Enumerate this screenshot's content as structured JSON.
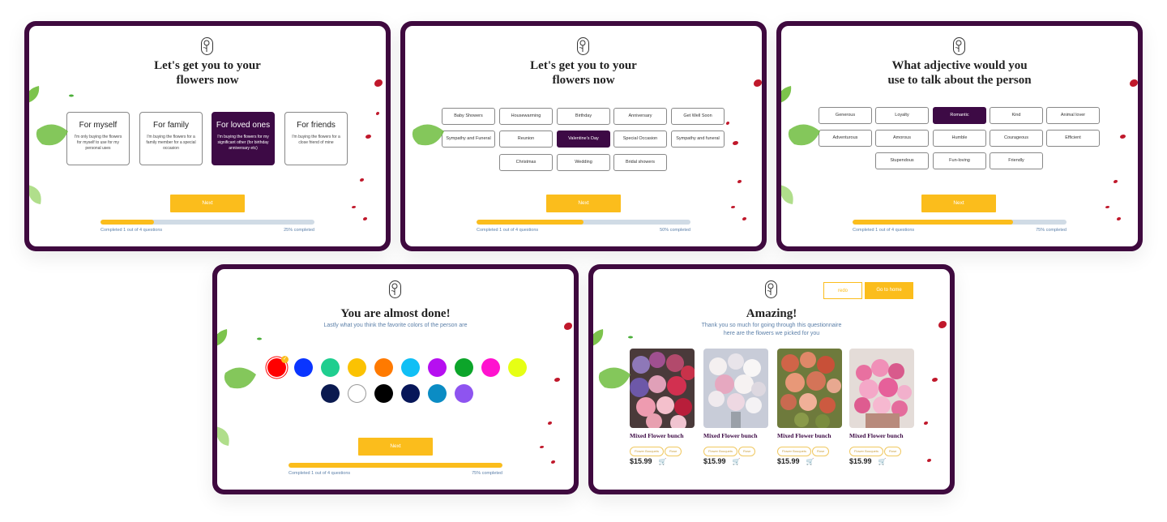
{
  "screens": {
    "s1": {
      "title_line1": "Let's get you to your",
      "title_line2": "flowers now",
      "cards": [
        {
          "title": "For myself",
          "desc": "I'm only buying the flowers for myself to use for my personal uses",
          "selected": false
        },
        {
          "title": "For family",
          "desc": "I'm buying the flowers for a family member for a special occasion",
          "selected": false
        },
        {
          "title": "For loved ones",
          "desc": "I'm buying the flowers for my significant other (for birthday anniversary etc)",
          "selected": true
        },
        {
          "title": "For friends",
          "desc": "I'm buying the flowers for a close friend of mine",
          "selected": false
        }
      ],
      "next_label": "Next",
      "progress_left": "Completed 1 out of 4 questions",
      "progress_right": "25% completed",
      "progress_value": 0.25
    },
    "s2": {
      "title_line1": "Let's get you to your",
      "title_line2": "flowers now",
      "chips": [
        {
          "label": "Baby Showers",
          "selected": false
        },
        {
          "label": "Housewarming",
          "selected": false
        },
        {
          "label": "Birthday",
          "selected": false
        },
        {
          "label": "Anniversary",
          "selected": false
        },
        {
          "label": "Get Well Soon",
          "selected": false
        },
        {
          "label": "Sympathy and Funeral",
          "selected": false
        },
        {
          "label": "Reunion",
          "selected": false
        },
        {
          "label": "Valentine's Day",
          "selected": true
        },
        {
          "label": "Special Occasion",
          "selected": false
        },
        {
          "label": "Sympathy and funeral",
          "selected": false
        },
        {
          "label": "Christmas",
          "selected": false
        },
        {
          "label": "Wedding",
          "selected": false
        },
        {
          "label": "Bridal showers",
          "selected": false
        }
      ],
      "next_label": "Next",
      "progress_left": "Completed 1 out of 4 questions",
      "progress_right": "50% completed",
      "progress_value": 0.5
    },
    "s3": {
      "title_line1": "What adjective would you",
      "title_line2": "use to talk about the person",
      "chips": [
        {
          "label": "Generous",
          "selected": false
        },
        {
          "label": "Loyalty",
          "selected": false
        },
        {
          "label": "Romantic",
          "selected": true
        },
        {
          "label": "Kind",
          "selected": false
        },
        {
          "label": "Animal lover",
          "selected": false
        },
        {
          "label": "Adventurous",
          "selected": false
        },
        {
          "label": "Amorous",
          "selected": false
        },
        {
          "label": "Humble",
          "selected": false
        },
        {
          "label": "Courageous",
          "selected": false
        },
        {
          "label": "Efficient",
          "selected": false
        },
        {
          "label": "Stupendous",
          "selected": false
        },
        {
          "label": "Fun-loving",
          "selected": false
        },
        {
          "label": "Friendly",
          "selected": false
        }
      ],
      "next_label": "Next",
      "progress_left": "Completed 1 out of 4 questions",
      "progress_right": "75% completed",
      "progress_value": 0.75
    },
    "s4": {
      "title": "You are almost done!",
      "subtitle": "Lastly what you think the favorite colors of the person are",
      "colors": [
        {
          "hex": "#ff0000",
          "selected": true
        },
        {
          "hex": "#0a35ff",
          "selected": false
        },
        {
          "hex": "#1fce8f",
          "selected": false
        },
        {
          "hex": "#fbc202",
          "selected": false
        },
        {
          "hex": "#ff7a00",
          "selected": false
        },
        {
          "hex": "#10bff5",
          "selected": false
        },
        {
          "hex": "#b60ff0",
          "selected": false
        },
        {
          "hex": "#0ca52a",
          "selected": false
        },
        {
          "hex": "#ff12cf",
          "selected": false
        },
        {
          "hex": "#e6ff14",
          "selected": false
        },
        {
          "hex": "#0b1a50",
          "selected": false
        },
        {
          "hex": "#ffffff",
          "selected": false
        },
        {
          "hex": "#000000",
          "selected": false
        },
        {
          "hex": "#071659",
          "selected": false
        },
        {
          "hex": "#0b8cc4",
          "selected": false
        },
        {
          "hex": "#8e54f0",
          "selected": false
        }
      ],
      "next_label": "Next",
      "progress_left": "Completed 1 out of 4 questions",
      "progress_right": "75% completed",
      "progress_value": 1.0
    },
    "s5": {
      "redo_label": "redo",
      "home_label": "Go to home",
      "title": "Amazing!",
      "subtitle_line1": "Thank you so much for going through this questionnaire",
      "subtitle_line2": "here are the flowers we picked for you",
      "products": [
        {
          "name": "Mixed Flower bunch",
          "tags": [
            "Flower Bouquets",
            "Rose"
          ],
          "price": "$15.99"
        },
        {
          "name": "Mixed Flower bunch",
          "tags": [
            "Flower Bouquets",
            "Rose"
          ],
          "price": "$15.99"
        },
        {
          "name": "Mixed Flower bunch",
          "tags": [
            "Flower Bouquets",
            "Rose"
          ],
          "price": "$15.99"
        },
        {
          "name": "Mixed Flower bunch",
          "tags": [
            "Flower Bouquets",
            "Rose"
          ],
          "price": "$15.99"
        }
      ]
    }
  },
  "colors": {
    "frame": "#3f0a3f",
    "accent": "#fbbd1c",
    "selected": "#3d0a45",
    "muted_text": "#5b7fa8"
  },
  "icons": {
    "logo": "rose-logo-icon",
    "cart": "cart-icon",
    "leaf": "leaf-icon",
    "petal": "petal-icon"
  }
}
